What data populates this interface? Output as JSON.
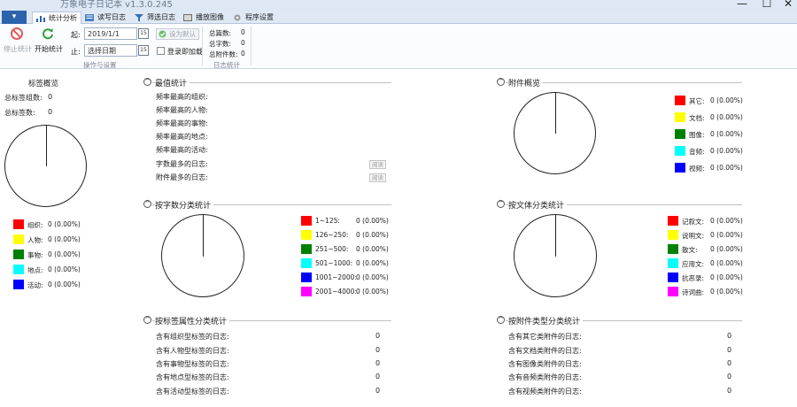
{
  "window": {
    "title": "万象电子日记本 v1.3.0.245",
    "minimize": "—",
    "maximize": "☐",
    "close": "✕"
  },
  "tabs": [
    {
      "label": "统计分析",
      "icon": "bar-chart-icon",
      "active": true
    },
    {
      "label": "读写日志",
      "icon": "book-icon",
      "active": false
    },
    {
      "label": "筛选日志",
      "icon": "filter-icon",
      "active": false
    },
    {
      "label": "播放图像",
      "icon": "image-icon",
      "active": false
    },
    {
      "label": "程序设置",
      "icon": "gear-icon",
      "active": false
    }
  ],
  "ribbon": {
    "stop_label": "停止统计",
    "start_label": "开始统计",
    "from_label": "起:",
    "to_label": "止:",
    "from_value": "2019/1/1",
    "to_value": "选择日期",
    "calendar_text": "15",
    "set_default_label": "设为默认",
    "login_load_label": "登录即加载",
    "group_ops": "操作与设置",
    "stats": {
      "total_count_label": "总篇数:",
      "total_count": "0",
      "total_chars_label": "总字数:",
      "total_chars": "0",
      "total_attach_label": "总附件数:",
      "total_attach": "0"
    },
    "group_stats": "日志统计"
  },
  "tag_overview": {
    "title": "标签概览",
    "group_count_label": "总标签组数:",
    "group_count": "0",
    "tag_count_label": "总标签数:",
    "tag_count": "0",
    "legend": [
      {
        "label": "组织:",
        "value": "0 (0.00%)",
        "color": "#ff0000"
      },
      {
        "label": "人物:",
        "value": "0 (0.00%)",
        "color": "#ffff00"
      },
      {
        "label": "事物:",
        "value": "0 (0.00%)",
        "color": "#008000"
      },
      {
        "label": "地点:",
        "value": "0 (0.00%)",
        "color": "#00ffff"
      },
      {
        "label": "活动:",
        "value": "0 (0.00%)",
        "color": "#0000ff"
      }
    ]
  },
  "max_stats": {
    "title": "最值统计",
    "rows": [
      "频率最高的组织:",
      "频率最高的人物:",
      "频率最高的事物:",
      "频率最高的地点:",
      "频率最高的活动:",
      "字数最多的日志:",
      "附件最多的日志:"
    ],
    "open_label": "阅读"
  },
  "attach_overview": {
    "title": "附件概览",
    "legend": [
      {
        "label": "其它:",
        "value": "0 (0.00%)",
        "color": "#ff0000"
      },
      {
        "label": "文档:",
        "value": "0 (0.00%)",
        "color": "#ffff00"
      },
      {
        "label": "图像:",
        "value": "0 (0.00%)",
        "color": "#008000"
      },
      {
        "label": "音频:",
        "value": "0 (0.00%)",
        "color": "#00ffff"
      },
      {
        "label": "视频:",
        "value": "0 (0.00%)",
        "color": "#0000ff"
      }
    ]
  },
  "by_length": {
    "title": "按字数分类统计",
    "legend": [
      {
        "label": "1~125:",
        "value": "0 (0.00%)",
        "color": "#ff0000"
      },
      {
        "label": "126~250:",
        "value": "0 (0.00%)",
        "color": "#ffff00"
      },
      {
        "label": "251~500:",
        "value": "0 (0.00%)",
        "color": "#008000"
      },
      {
        "label": "501~1000:",
        "value": "0 (0.00%)",
        "color": "#00ffff"
      },
      {
        "label": "1001~2000:",
        "value": "0 (0.00%)",
        "color": "#0000ff"
      },
      {
        "label": "2001~4000:",
        "value": "0 (0.00%)",
        "color": "#ff00ff"
      }
    ]
  },
  "by_genre": {
    "title": "按文体分类统计",
    "legend": [
      {
        "label": "记叙文:",
        "value": "0 (0.00%)",
        "color": "#ff0000"
      },
      {
        "label": "说明文:",
        "value": "0 (0.00%)",
        "color": "#ffff00"
      },
      {
        "label": "散文:",
        "value": "0 (0.00%)",
        "color": "#008000"
      },
      {
        "label": "应用文:",
        "value": "0 (0.00%)",
        "color": "#00ffff"
      },
      {
        "label": "抗恶录:",
        "value": "0 (0.00%)",
        "color": "#0000ff"
      },
      {
        "label": "诗词曲:",
        "value": "0 (0.00%)",
        "color": "#ff00ff"
      }
    ]
  },
  "by_tag_attr": {
    "title": "按标签属性分类统计",
    "rows": [
      {
        "label": "含有组织型标签的日志:",
        "value": "0"
      },
      {
        "label": "含有人物型标签的日志:",
        "value": "0"
      },
      {
        "label": "含有事物型标签的日志:",
        "value": "0"
      },
      {
        "label": "含有地点型标签的日志:",
        "value": "0"
      },
      {
        "label": "含有活动型标签的日志:",
        "value": "0"
      }
    ]
  },
  "by_attach_type": {
    "title": "按附件类型分类统计",
    "rows": [
      {
        "label": "含有其它类附件的日志:",
        "value": "0"
      },
      {
        "label": "含有文档类附件的日志:",
        "value": "0"
      },
      {
        "label": "含有图像类附件的日志:",
        "value": "0"
      },
      {
        "label": "含有音频类附件的日志:",
        "value": "0"
      },
      {
        "label": "含有视频类附件的日志:",
        "value": "0"
      }
    ]
  }
}
